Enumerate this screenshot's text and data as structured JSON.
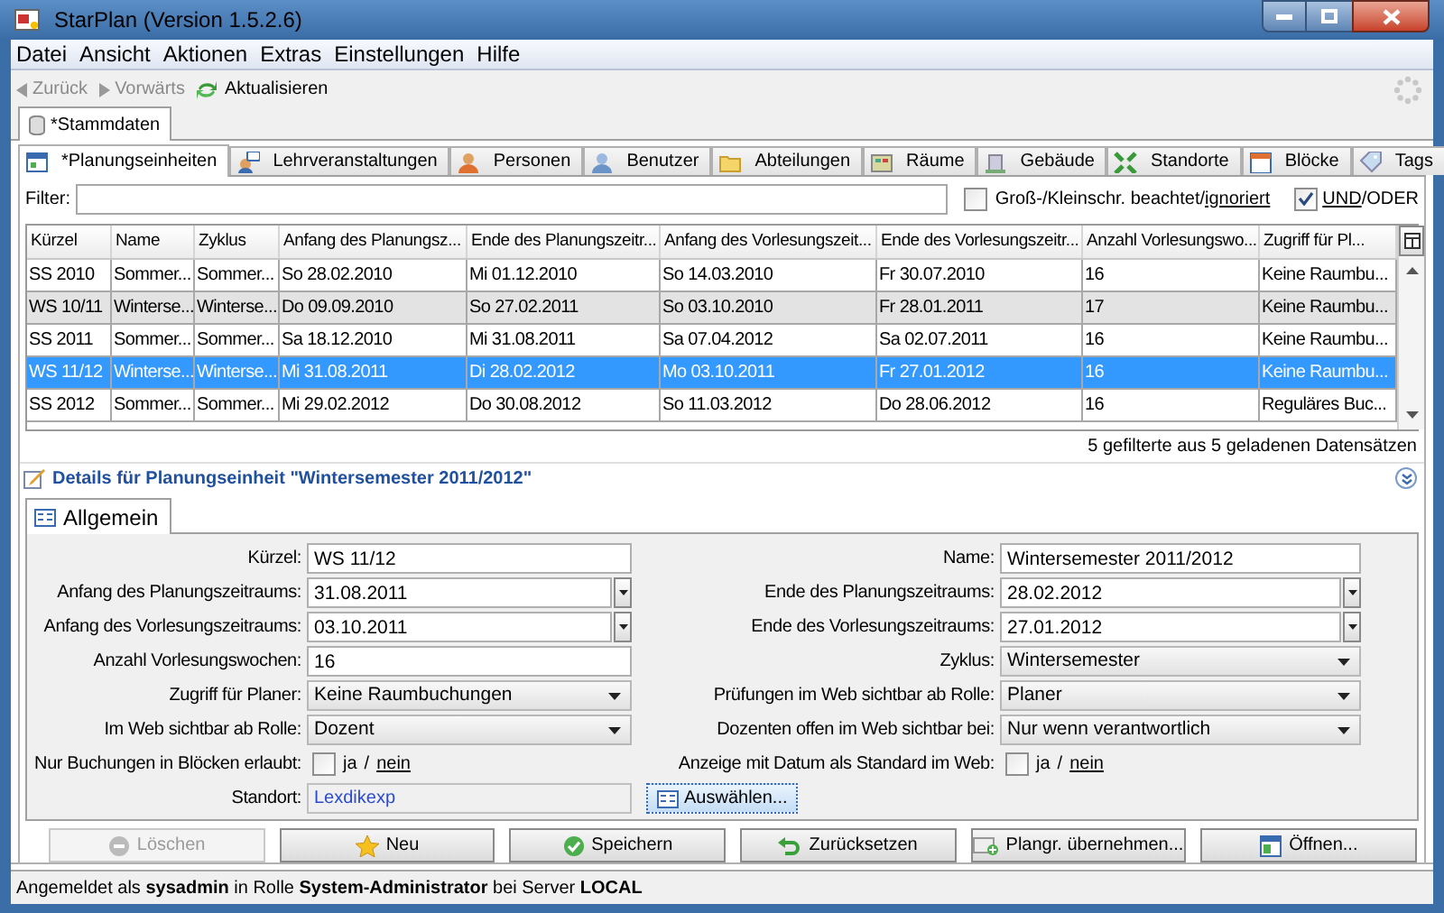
{
  "window": {
    "title": "StarPlan (Version 1.5.2.6)"
  },
  "menu": [
    "Datei",
    "Ansicht",
    "Aktionen",
    "Extras",
    "Einstellungen",
    "Hilfe"
  ],
  "toolbar": [
    {
      "label": "Zurück",
      "disabled": true
    },
    {
      "label": "Vorwärts",
      "disabled": true
    },
    {
      "label": "Aktualisieren",
      "disabled": false
    }
  ],
  "outer_tabs": [
    {
      "label": "*Stammdaten",
      "selected": true
    }
  ],
  "inner_tabs": [
    {
      "label": "*Planungseinheiten",
      "selected": true
    },
    {
      "label": "Lehrveranstaltungen",
      "selected": false
    },
    {
      "label": "Personen",
      "selected": false
    },
    {
      "label": "Benutzer",
      "selected": false
    },
    {
      "label": "Abteilungen",
      "selected": false
    },
    {
      "label": "Räume",
      "selected": false
    },
    {
      "label": "Gebäude",
      "selected": false
    },
    {
      "label": "Standorte",
      "selected": false
    },
    {
      "label": "Blöcke",
      "selected": false
    },
    {
      "label": "Tags",
      "selected": false
    }
  ],
  "filter": {
    "label": "Filter:"
  },
  "case_option": {
    "checked": false,
    "label": "Groß-/Kleinschr. beachtet/",
    "link": "ignoriert"
  },
  "logic_option": {
    "checked": true,
    "link": "UND",
    "label": "/ODER"
  },
  "table": {
    "columns": [
      "Kürzel",
      "Name",
      "Zyklus",
      "Anfang des Planungsz...",
      "Ende des Planungszeitr...",
      "Anfang des Vorlesungszeit...",
      "Ende des Vorlesungszeitr...",
      "Anzahl Vorlesungswo...",
      "Zugriff für Pl..."
    ],
    "rows": [
      {
        "selected": false,
        "hovered": false,
        "cells": [
          "SS 2010",
          "Sommer...",
          "Sommer...",
          "So 28.02.2010",
          "Mi 01.12.2010",
          "So 14.03.2010",
          "Fr 30.07.2010",
          "16",
          "Keine Raumbu..."
        ]
      },
      {
        "selected": false,
        "hovered": true,
        "cells": [
          "WS 10/11",
          "Winterse...",
          "Winterse...",
          "Do 09.09.2010",
          "So 27.02.2011",
          "So 03.10.2010",
          "Fr 28.01.2011",
          "17",
          "Keine Raumbu..."
        ]
      },
      {
        "selected": false,
        "hovered": false,
        "cells": [
          "SS 2011",
          "Sommer...",
          "Sommer...",
          "Sa 18.12.2010",
          "Mi 31.08.2011",
          "Sa 07.04.2012",
          "Sa 02.07.2011",
          "16",
          "Keine Raumbu..."
        ]
      },
      {
        "selected": true,
        "hovered": false,
        "cells": [
          "WS 11/12",
          "Winterse...",
          "Winterse...",
          "Mi 31.08.2011",
          "Di 28.02.2012",
          "Mo 03.10.2011",
          "Fr 27.01.2012",
          "16",
          "Keine Raumbu..."
        ]
      },
      {
        "selected": false,
        "hovered": false,
        "cells": [
          "SS 2012",
          "Sommer...",
          "Sommer...",
          "Mi 29.02.2012",
          "Do 30.08.2012",
          "So 11.03.2012",
          "Do 28.06.2012",
          "16",
          "Reguläres Buc..."
        ]
      }
    ]
  },
  "record_count": "5 gefilterte aus 5 geladenen Datensätzen",
  "details": {
    "title": "Details für Planungseinheit \"Wintersemester 2011/2012\"",
    "tabs": [
      {
        "label": "Allgemein",
        "selected": true
      }
    ],
    "rows": [
      [
        {
          "label": "Kürzel:",
          "kind": "text",
          "value": "WS 11/12"
        },
        {
          "label": "Name:",
          "kind": "text",
          "value": "Wintersemester 2011/2012"
        }
      ],
      [
        {
          "label": "Anfang des Planungszeitraums:",
          "kind": "date",
          "value": "31.08.2011"
        },
        {
          "label": "Ende des Planungszeitraums:",
          "kind": "date",
          "value": "28.02.2012"
        }
      ],
      [
        {
          "label": "Anfang des Vorlesungszeitraums:",
          "kind": "date",
          "value": "03.10.2011"
        },
        {
          "label": "Ende des Vorlesungszeitraums:",
          "kind": "date",
          "value": "27.01.2012"
        }
      ],
      [
        {
          "label": "Anzahl Vorlesungswochen:",
          "kind": "text",
          "value": "16"
        },
        {
          "label": "Zyklus:",
          "kind": "select",
          "value": "Wintersemester"
        }
      ],
      [
        {
          "label": "Zugriff für Planer:",
          "kind": "select",
          "value": "Keine Raumbuchungen"
        },
        {
          "label": "Prüfungen im Web sichtbar ab Rolle:",
          "kind": "select",
          "value": "Planer"
        }
      ],
      [
        {
          "label": "Im Web sichtbar ab Rolle:",
          "kind": "select",
          "value": "Dozent"
        },
        {
          "label": "Dozenten offen im Web sichtbar bei:",
          "kind": "select",
          "value": "Nur wenn verantwortlich"
        }
      ],
      [
        {
          "label": "Nur Buchungen in Blöcken erlaubt:",
          "kind": "checkbox",
          "checked": false,
          "yes": "ja",
          "separator": "/",
          "no": "nein"
        },
        {
          "label": "Anzeige mit Datum als Standard im Web:",
          "kind": "checkbox",
          "checked": false,
          "yes": "ja",
          "separator": "/",
          "no": "nein"
        }
      ],
      [
        {
          "label": "Standort:",
          "kind": "link",
          "value": "Lexdikexp"
        },
        {
          "kind": "button",
          "label": "Auswählen..."
        }
      ]
    ]
  },
  "buttons": [
    {
      "label": "Löschen",
      "disabled": true
    },
    {
      "label": "Neu",
      "disabled": false
    },
    {
      "label": "Speichern",
      "disabled": false
    },
    {
      "label": "Zurücksetzen",
      "disabled": false
    },
    {
      "label": "Plangr. übernehmen...",
      "disabled": false
    },
    {
      "label": "Öffnen...",
      "disabled": false
    }
  ],
  "status_bar": "Angemeldet als **sysadmin** in Rolle **System-Administrator** bei Server **LOCAL**"
}
